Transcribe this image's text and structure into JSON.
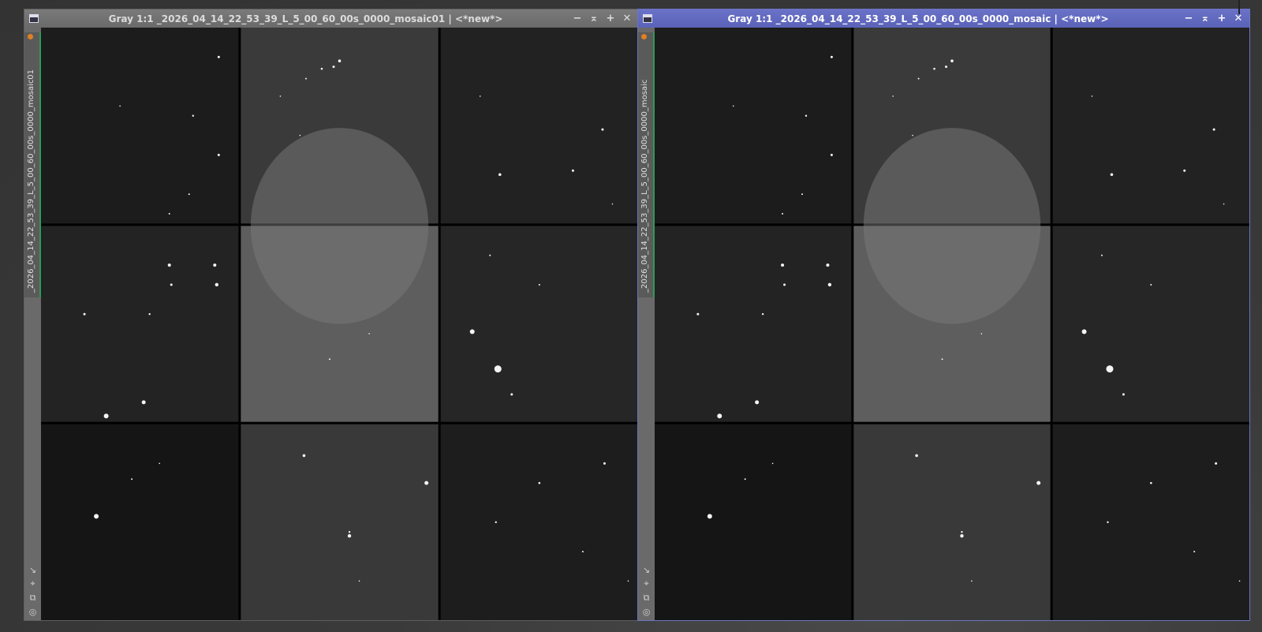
{
  "windows": [
    {
      "id": "left",
      "title": "Gray 1:1 _2026_04_14_22_53_39_L_5_00_60_00s_0000_mosaic01 | <*new*>",
      "tab_label": "_2026_04_14_22_53_39_L_5_00_60_00s_0000_mosaic01",
      "active": false
    },
    {
      "id": "right",
      "title": "Gray 1:1 _2026_04_14_22_53_39_L_5_00_60_00s_0000_mosaic | <*new*>",
      "tab_label": "_2026_04_14_22_53_39_L_5_00_60_00s_0000_mosaic",
      "active": true
    }
  ],
  "controls": {
    "minimize": "−",
    "shade": "⌅",
    "maximize": "+",
    "close": "✕"
  },
  "side_icons": [
    "↘",
    "⌖",
    "⧉",
    "◎"
  ],
  "colors": {
    "active_title": "#5a62b8",
    "inactive_title": "#6a6a6a",
    "tab_accent": "#2f9a55"
  }
}
